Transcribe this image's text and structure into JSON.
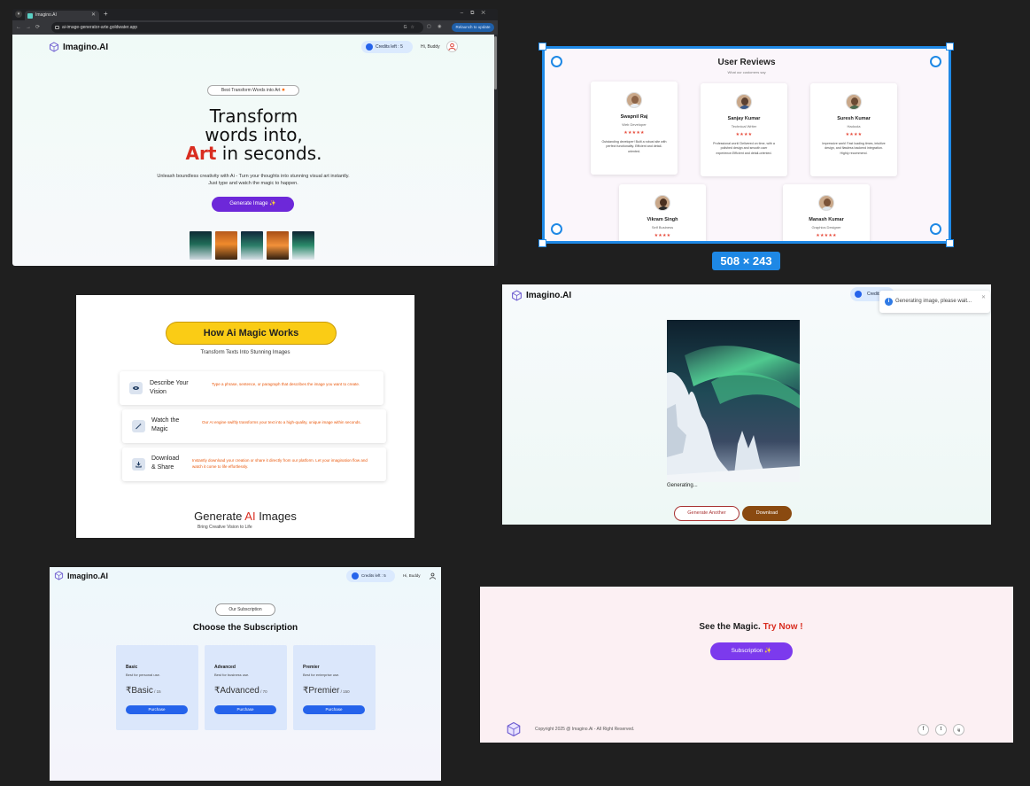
{
  "browser": {
    "tab_title": "Imagino.AI",
    "url": "ai-image-generator-arte.goldwater.app",
    "update_label": "Relaunch to update",
    "brand": "Imagino.AI",
    "credits": "Credits left : 5",
    "greeting": "Hi, Buddy",
    "pill": "Best Transform Words into Art",
    "headline_line1": "Transform",
    "headline_line2": "words into,",
    "headline_art": "Art",
    "headline_end": "in seconds.",
    "subtitle": "Unleash boundless creativity with Ai - Turn your thoughts into stunning visual art instantly. Just type and watch the magic to happen.",
    "generate_label": "Generate Image"
  },
  "reviews": {
    "title": "User Reviews",
    "caption": "What our customers say",
    "dimensions_label": "508 × 243",
    "items": [
      {
        "name": "Swapnil Raj",
        "role": "Web Developer",
        "stars": "★★★★★",
        "text": "Outstanding developer! Built a robust site with perfect functionality. Efficient and detail-oriented."
      },
      {
        "name": "Sanjay Kumar",
        "role": "Technical Writer",
        "stars": "★★★★",
        "text": "Professional work! Delivered on time, with a polished design and smooth user experience.Efficient and detail-oriented."
      },
      {
        "name": "Suresh Kumar",
        "role": "Hadoola",
        "stars": "★★★★",
        "text": "Impressive work! Fast loading times, intuitive design, and flawless backend integration. Highly recommend."
      },
      {
        "name": "Vikram Singh",
        "role": "Self Business",
        "stars": "★★★★",
        "text": ""
      },
      {
        "name": "Manash Kumar",
        "role": "Graphics Designer",
        "stars": "★★★★★",
        "text": ""
      }
    ]
  },
  "how": {
    "button": "How Ai Magic Works",
    "subtitle": "Transform Texts Into Stunning Images",
    "steps": [
      {
        "title_1": "Describe Your",
        "title_2": "Vision",
        "desc": "Type a phrase, sentence, or paragraph that describes the image you want to create."
      },
      {
        "title_1": "Watch the",
        "title_2": "Magic",
        "desc": "Our AI engine swiftly transforms your text into a high-quality, unique image within seconds."
      },
      {
        "title_1": "Download",
        "title_2": "& Share",
        "desc": "Instantly download your creation or share it directly from our platform. Let your imagination flow and watch it come to life effortlessly."
      }
    ],
    "gen_pre": "Generate ",
    "gen_ai": "AI",
    "gen_post": " Images",
    "gen_sub": "Bring Creative Vision to Life"
  },
  "generating": {
    "brand": "Imagino.AI",
    "credits": "Credits",
    "toast": "Generating image, please wait...",
    "status": "Generating...",
    "another": "Generate Another",
    "download": "Download"
  },
  "subscription": {
    "brand": "Imagino.AI",
    "credits": "Credits left : 5",
    "greeting": "Hi, Buddy",
    "pill": "Our Subscription",
    "title": "Choose the Subscription",
    "plans": [
      {
        "name": "Basic",
        "desc": "Best for personal use.",
        "price": "₹Basic",
        "per": " / 15",
        "button": "Purchase"
      },
      {
        "name": "Advanced",
        "desc": "Best for business use.",
        "price": "₹Advanced",
        "per": " / 70",
        "button": "Purchase"
      },
      {
        "name": "Premier",
        "desc": "Best for enterprise use.",
        "price": "₹Premier",
        "per": " / 150",
        "button": "Purchase"
      }
    ]
  },
  "footer": {
    "see_pre": "See the Magic. ",
    "see_try": "Try Now !",
    "subscription_label": "Subscription",
    "copyright": "Copyright 2025 @ Imagino.Ai - All Right Reserved.",
    "social": [
      "f",
      "t",
      "ig"
    ]
  },
  "colors": {
    "accent_purple": "#6d28d9",
    "accent_blue": "#2563eb",
    "accent_red": "#d92d20",
    "accent_yellow": "#facc15",
    "selection_blue": "#1e88e5"
  }
}
